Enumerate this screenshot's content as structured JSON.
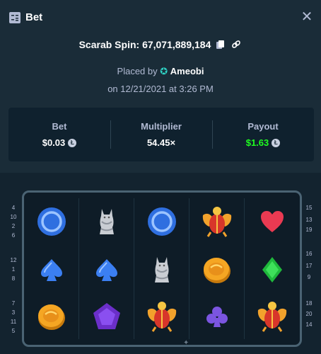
{
  "header": {
    "title": "Bet",
    "close_icon": "close-icon",
    "bet_icon": "bet-slip-icon"
  },
  "spin": {
    "title": "Scarab Spin: 67,071,889,184",
    "copy_icon": "copy-icon",
    "link_icon": "link-icon"
  },
  "placed": {
    "prefix": "Placed by",
    "user": "Ameobi",
    "badge_icon": "star-icon",
    "date": "on 12/21/2021 at 3:26 PM"
  },
  "stats": {
    "bet": {
      "label": "Bet",
      "value": "$0.03"
    },
    "multiplier": {
      "label": "Multiplier",
      "value": "54.45×"
    },
    "payout": {
      "label": "Payout",
      "value": "$1.63"
    },
    "coin_icon": "litecoin-icon",
    "payout_color": "#1fff20"
  },
  "board": {
    "reels": [
      [
        "blue-orb",
        "spade",
        "gold-coin"
      ],
      [
        "cat-statue",
        "spade",
        "purple-gem"
      ],
      [
        "blue-orb",
        "cat-statue",
        "scarab"
      ],
      [
        "scarab",
        "gold-coin",
        "club"
      ],
      [
        "heart",
        "green-diamond",
        "scarab"
      ]
    ],
    "left_numbers": [
      "4",
      "10",
      "2",
      "6",
      "12",
      "1",
      "8",
      "7",
      "3",
      "11",
      "5"
    ],
    "right_numbers": [
      "15",
      "13",
      "19",
      "16",
      "17",
      "9",
      "18",
      "20",
      "14"
    ]
  }
}
